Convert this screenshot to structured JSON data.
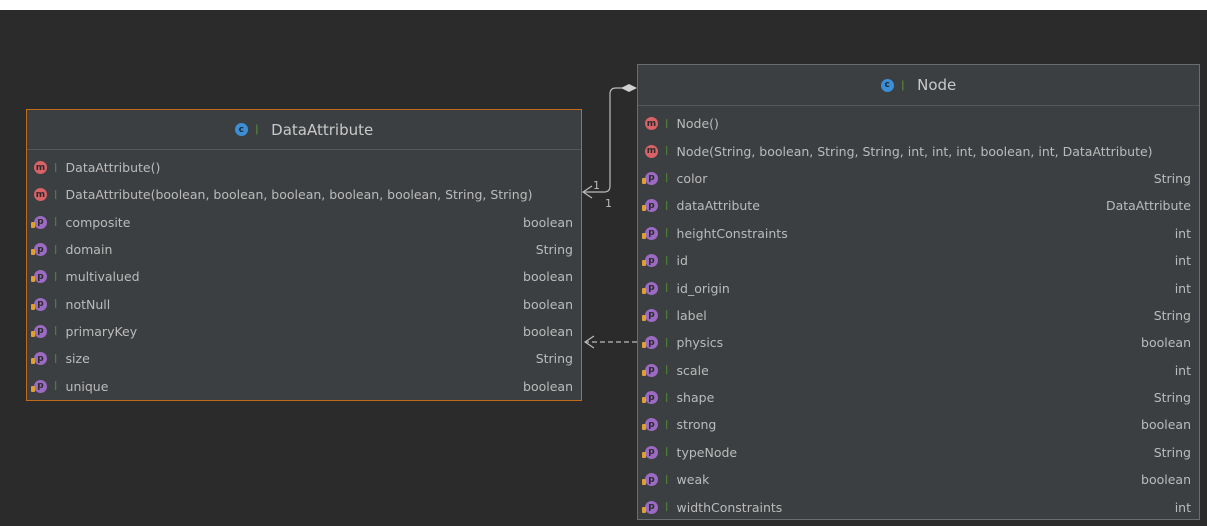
{
  "classes": {
    "data_attribute": {
      "name": "DataAttribute",
      "members": [
        {
          "kind": "m",
          "name": "DataAttribute()",
          "type": ""
        },
        {
          "kind": "m",
          "name": "DataAttribute(boolean, boolean, boolean, boolean, boolean, String, String)",
          "type": ""
        },
        {
          "kind": "p",
          "name": "composite",
          "type": "boolean"
        },
        {
          "kind": "p",
          "name": "domain",
          "type": "String"
        },
        {
          "kind": "p",
          "name": "multivalued",
          "type": "boolean"
        },
        {
          "kind": "p",
          "name": "notNull",
          "type": "boolean"
        },
        {
          "kind": "p",
          "name": "primaryKey",
          "type": "boolean"
        },
        {
          "kind": "p",
          "name": "size",
          "type": "String"
        },
        {
          "kind": "p",
          "name": "unique",
          "type": "boolean"
        }
      ]
    },
    "node": {
      "name": "Node",
      "members": [
        {
          "kind": "m",
          "name": "Node()",
          "type": ""
        },
        {
          "kind": "m",
          "name": "Node(String, boolean, String, String, int, int, int, boolean, int, DataAttribute)",
          "type": ""
        },
        {
          "kind": "p",
          "name": "color",
          "type": "String"
        },
        {
          "kind": "p",
          "name": "dataAttribute",
          "type": "DataAttribute"
        },
        {
          "kind": "p",
          "name": "heightConstraints",
          "type": "int"
        },
        {
          "kind": "p",
          "name": "id",
          "type": "int"
        },
        {
          "kind": "p",
          "name": "id_origin",
          "type": "int"
        },
        {
          "kind": "p",
          "name": "label",
          "type": "String"
        },
        {
          "kind": "p",
          "name": "physics",
          "type": "boolean"
        },
        {
          "kind": "p",
          "name": "scale",
          "type": "int"
        },
        {
          "kind": "p",
          "name": "shape",
          "type": "String"
        },
        {
          "kind": "p",
          "name": "strong",
          "type": "boolean"
        },
        {
          "kind": "p",
          "name": "typeNode",
          "type": "String"
        },
        {
          "kind": "p",
          "name": "weak",
          "type": "boolean"
        },
        {
          "kind": "p",
          "name": "widthConstraints",
          "type": "int"
        }
      ]
    }
  },
  "icons": {
    "class": "class-icon",
    "method": "method-icon",
    "property": "property-icon",
    "visibility": "public-lock-icon"
  },
  "badge_letters": {
    "class": "c",
    "method": "m",
    "property": "p"
  },
  "relations": {
    "composition": {
      "source_multiplicity": "1",
      "target_multiplicity": "1"
    }
  },
  "colors": {
    "background": "#2b2b2b",
    "selected_border": "#c06a1c",
    "box_fill": "#3c3f41"
  }
}
